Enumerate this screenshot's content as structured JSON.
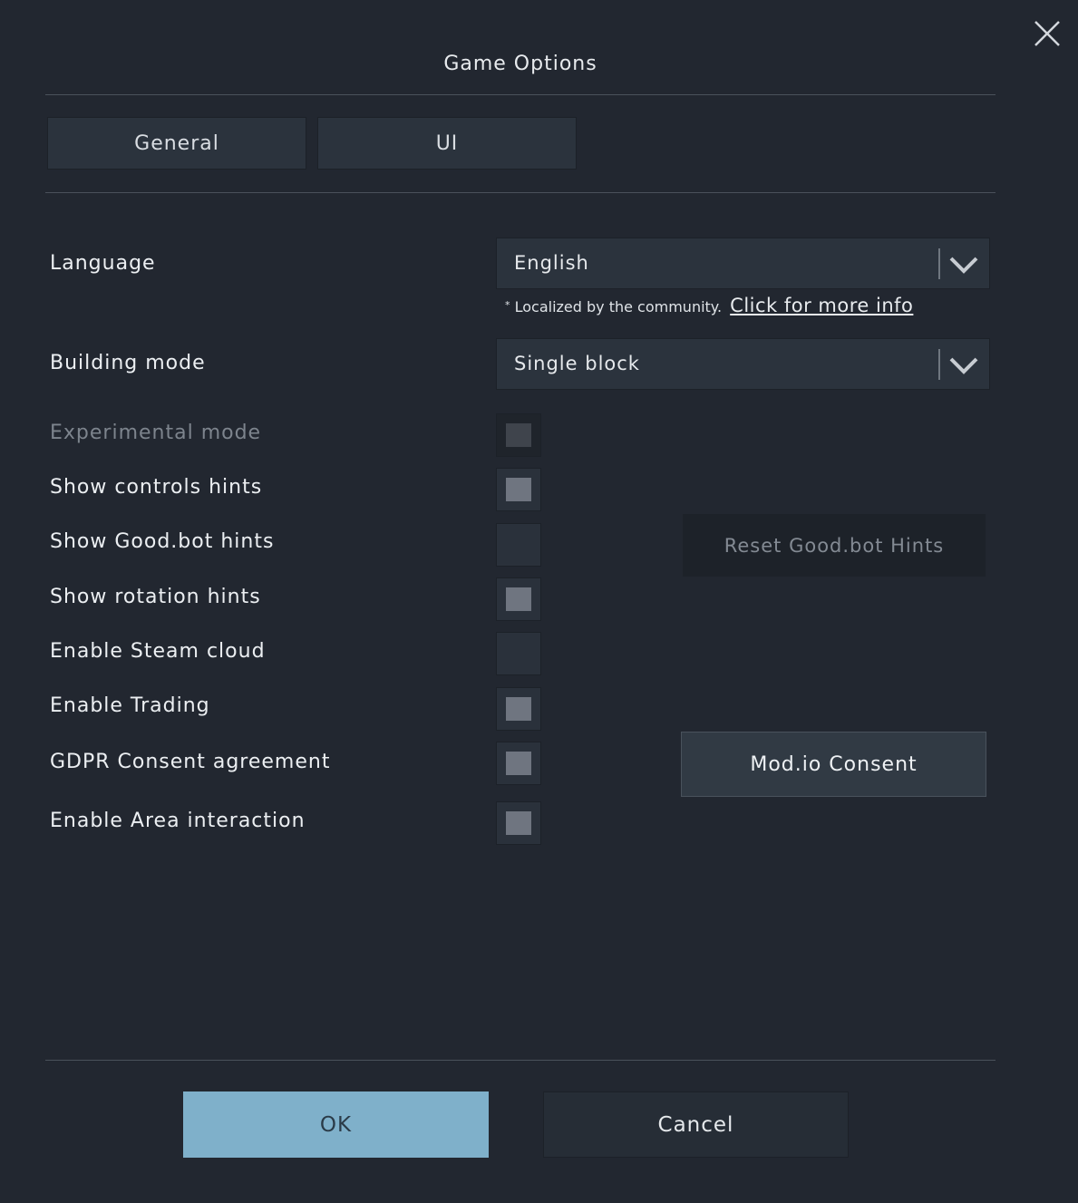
{
  "dialog": {
    "title": "Game Options",
    "close_icon": "close-icon"
  },
  "tabs": [
    {
      "label": "General"
    },
    {
      "label": "UI"
    }
  ],
  "language": {
    "label": "Language",
    "value": "English",
    "note_text": "Localized by the community.",
    "note_marker": "*",
    "note_link": "Click for more info",
    "icon": "chevron-down-icon"
  },
  "building_mode": {
    "label": "Building mode",
    "value": "Single block",
    "icon": "chevron-down-icon"
  },
  "options": [
    {
      "label": "Experimental mode",
      "checked": true,
      "disabled": true
    },
    {
      "label": "Show controls hints",
      "checked": true,
      "disabled": false
    },
    {
      "label": "Show Good.bot hints",
      "checked": false,
      "disabled": false
    },
    {
      "label": "Show rotation hints",
      "checked": true,
      "disabled": false
    },
    {
      "label": "Enable Steam cloud",
      "checked": false,
      "disabled": false
    },
    {
      "label": "Enable Trading",
      "checked": true,
      "disabled": false
    },
    {
      "label": "GDPR Consent agreement",
      "checked": true,
      "disabled": false
    },
    {
      "label": "Enable Area interaction",
      "checked": true,
      "disabled": false
    }
  ],
  "buttons": {
    "reset_goodbot": "Reset Good.bot Hints",
    "modio_consent": "Mod.io Consent",
    "ok": "OK",
    "cancel": "Cancel"
  },
  "colors": {
    "background": "#222730",
    "primary_button": "#7fb0ca",
    "panel": "#2b333d"
  }
}
